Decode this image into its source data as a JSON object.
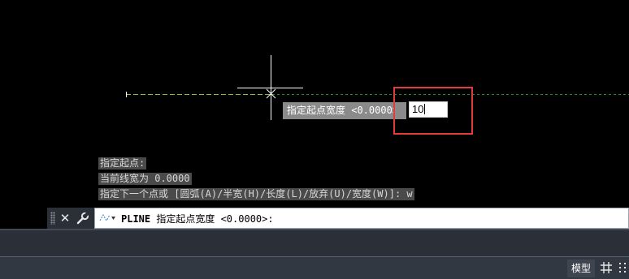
{
  "canvas": {
    "dynamic_tooltip": {
      "label": "指定起点宽度 <0.0000>",
      "input_value": "10"
    },
    "colors": {
      "polyline": "#8bbf3a",
      "polyline_dash": "#2f8a2f",
      "crosshair": "#ffffff",
      "highlight": "#e03c3c"
    }
  },
  "command_history": [
    "指定起点:",
    "当前线宽为 0.0000",
    "指定下一个点或 [圆弧(A)/半宽(H)/长度(L)/放弃(U)/宽度(W)]: w"
  ],
  "command_line": {
    "command": "PLINE",
    "prompt": " 指定起点宽度 <0.0000>:",
    "close_icon": "close-icon",
    "customize_icon": "wrench-icon"
  },
  "status_bar": {
    "model_label": "模型",
    "grid_icon": "grid-icon",
    "snap_icon": "snap-dots-icon"
  }
}
